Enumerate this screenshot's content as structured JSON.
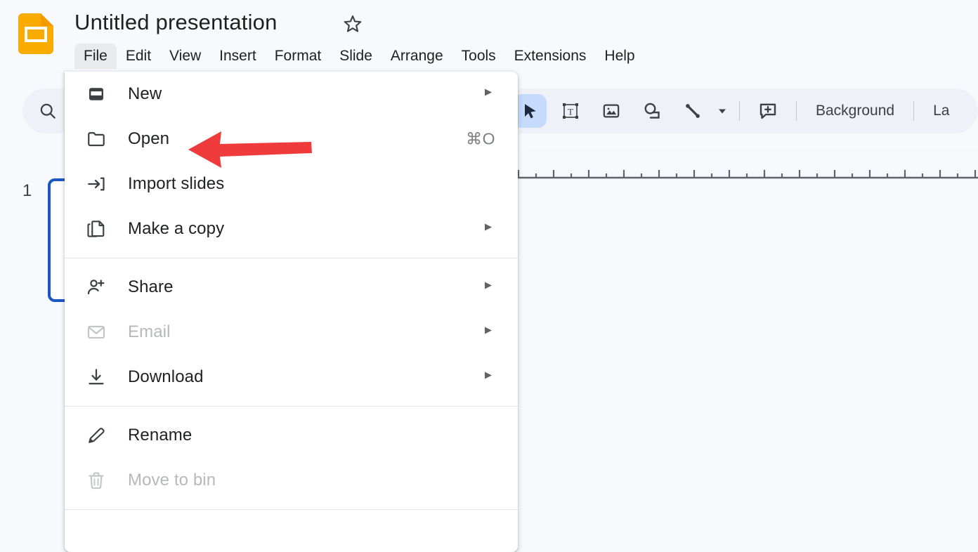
{
  "app": {
    "name": "Google Slides",
    "logo_icon": "slides-logo-icon",
    "logo_color": "#F9AB00"
  },
  "titlebar": {
    "document_title": "Untitled presentation",
    "star_icon": "star-outline-icon"
  },
  "menubar": {
    "items": [
      {
        "label": "File",
        "active": true
      },
      {
        "label": "Edit",
        "active": false
      },
      {
        "label": "View",
        "active": false
      },
      {
        "label": "Insert",
        "active": false
      },
      {
        "label": "Format",
        "active": false
      },
      {
        "label": "Slide",
        "active": false
      },
      {
        "label": "Arrange",
        "active": false
      },
      {
        "label": "Tools",
        "active": false
      },
      {
        "label": "Extensions",
        "active": false
      },
      {
        "label": "Help",
        "active": false
      }
    ]
  },
  "toolbar": {
    "search_icon": "search-icon",
    "new_slide_icon": "new-slide-icon",
    "cursor_icon": "select-cursor-icon",
    "textbox_icon": "text-box-icon",
    "image_icon": "insert-image-icon",
    "shape_icon": "insert-shape-icon",
    "line_icon": "insert-line-icon",
    "line_caret_icon": "chevron-down-icon",
    "comment_icon": "add-comment-icon",
    "background_label": "Background",
    "layout_label": "La",
    "selected_tool": "select-cursor-icon",
    "selected_highlight_color": "#c6dafc"
  },
  "slide_panel": {
    "slides": [
      {
        "number": "1",
        "selected": true
      }
    ],
    "selection_color": "#1a56c4"
  },
  "file_menu": {
    "groups": [
      {
        "items": [
          {
            "label": "New",
            "icon": "new-presentation-icon",
            "submenu": true,
            "shortcut": "",
            "disabled": false
          },
          {
            "label": "Open",
            "icon": "folder-open-icon",
            "submenu": false,
            "shortcut": "⌘O",
            "disabled": false
          },
          {
            "label": "Import slides",
            "icon": "import-slides-icon",
            "submenu": false,
            "shortcut": "",
            "disabled": false
          },
          {
            "label": "Make a copy",
            "icon": "copy-icon",
            "submenu": true,
            "shortcut": "",
            "disabled": false
          }
        ]
      },
      {
        "items": [
          {
            "label": "Share",
            "icon": "person-add-icon",
            "submenu": true,
            "shortcut": "",
            "disabled": false
          },
          {
            "label": "Email",
            "icon": "envelope-icon",
            "submenu": true,
            "shortcut": "",
            "disabled": true
          },
          {
            "label": "Download",
            "icon": "download-icon",
            "submenu": true,
            "shortcut": "",
            "disabled": false
          }
        ]
      },
      {
        "items": [
          {
            "label": "Rename",
            "icon": "pencil-icon",
            "submenu": false,
            "shortcut": "",
            "disabled": false
          },
          {
            "label": "Move to bin",
            "icon": "trash-icon",
            "submenu": false,
            "shortcut": "",
            "disabled": true
          }
        ]
      }
    ]
  },
  "annotation": {
    "type": "arrow",
    "direction": "left",
    "color": "#ef3b3b",
    "points_at": "Open"
  }
}
